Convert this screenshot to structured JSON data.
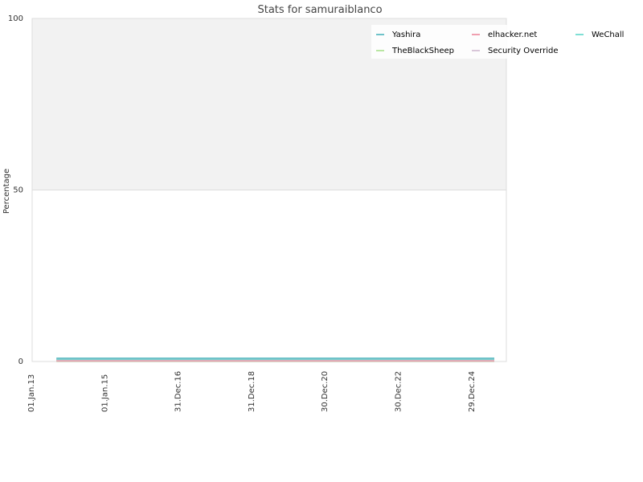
{
  "chart_data": {
    "type": "line",
    "title": "Stats for samuraiblanco",
    "xlabel": "",
    "ylabel": "Percentage",
    "ylim": [
      0,
      100
    ],
    "yticks": [
      "0",
      "50",
      "100"
    ],
    "x_ticks": [
      "01.Jan.13",
      "01.Jan.15",
      "31.Dec.16",
      "31.Dec.18",
      "30.Dec.20",
      "30.Dec.22",
      "29.Dec.24"
    ],
    "x_range": [
      "2013-01-01",
      "2025-12-31"
    ],
    "legend_position": "top-right",
    "grid": true,
    "background_bands": [
      "#f2f2f2",
      "#ffffff"
    ],
    "series": [
      {
        "name": "Yashira",
        "color": "#6fc3c9",
        "x": [
          "2013-09-01",
          "2025-09-01"
        ],
        "y": [
          0.9,
          0.9
        ]
      },
      {
        "name": "elhacker.net",
        "color": "#f0a0b0",
        "x": [
          "2013-09-01",
          "2025-09-01"
        ],
        "y": [
          0.3,
          0.3
        ]
      },
      {
        "name": "WeChall",
        "color": "#7fdfd5",
        "x": [
          "2013-09-01",
          "2025-09-01"
        ],
        "y": [
          0.7,
          0.7
        ]
      },
      {
        "name": "TheBlackSheep",
        "color": "#b9e6a2",
        "x": [
          "2013-09-01",
          "2025-09-01"
        ],
        "y": [
          0.2,
          0.2
        ]
      },
      {
        "name": "Security Override",
        "color": "#d9c7d9",
        "x": [
          "2013-09-01",
          "2025-09-01"
        ],
        "y": [
          0.1,
          0.1
        ]
      }
    ]
  }
}
